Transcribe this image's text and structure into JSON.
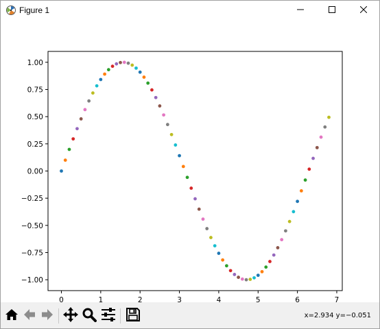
{
  "window": {
    "title": "Figure 1",
    "icons": {
      "app": "matplotlib-logo-icon",
      "minimize": "minimize-icon",
      "maximize": "maximize-icon",
      "close": "close-icon"
    }
  },
  "toolbar": {
    "buttons": [
      {
        "name": "home-button",
        "icon": "home-icon"
      },
      {
        "name": "back-button",
        "icon": "left-arrow-icon"
      },
      {
        "name": "forward-button",
        "icon": "right-arrow-icon"
      },
      {
        "name": "pan-button",
        "icon": "move-icon"
      },
      {
        "name": "zoom-button",
        "icon": "magnifier-icon"
      },
      {
        "name": "configure-subplots-button",
        "icon": "sliders-icon"
      },
      {
        "name": "save-button",
        "icon": "save-icon"
      }
    ],
    "status": "x=2.934 y=−0.051"
  },
  "chart_data": {
    "type": "scatter",
    "title": "",
    "xlabel": "",
    "ylabel": "",
    "xlim": [
      -0.34,
      7.14
    ],
    "ylim": [
      -1.1,
      1.1
    ],
    "xticks": [
      0,
      1,
      2,
      3,
      4,
      5,
      6,
      7
    ],
    "xtick_labels": [
      "0",
      "1",
      "2",
      "3",
      "4",
      "5",
      "6",
      "7"
    ],
    "yticks": [
      -1.0,
      -0.75,
      -0.5,
      -0.25,
      0.0,
      0.25,
      0.5,
      0.75,
      1.0
    ],
    "ytick_labels": [
      "−1.00",
      "−0.75",
      "−0.50",
      "−0.25",
      "0.00",
      "0.25",
      "0.50",
      "0.75",
      "1.00"
    ],
    "grid": false,
    "point_colors": [
      "#1f77b4",
      "#ff7f0e",
      "#2ca02c",
      "#d62728",
      "#9467bd",
      "#8c564b",
      "#e377c2",
      "#7f7f7f",
      "#bcbd22",
      "#17becf"
    ],
    "x": [
      0.0,
      0.1,
      0.2,
      0.3,
      0.4,
      0.5,
      0.6,
      0.7,
      0.8,
      0.9,
      1.0,
      1.1,
      1.2,
      1.3,
      1.4,
      1.5,
      1.6,
      1.7,
      1.8,
      1.9,
      2.0,
      2.1,
      2.2,
      2.3,
      2.4,
      2.5,
      2.6,
      2.7,
      2.8,
      2.9,
      3.0,
      3.1,
      3.2,
      3.3,
      3.4,
      3.5,
      3.6,
      3.7,
      3.8,
      3.9,
      4.0,
      4.1,
      4.2,
      4.3,
      4.4,
      4.5,
      4.6,
      4.7,
      4.8,
      4.9,
      5.0,
      5.1,
      5.2,
      5.3,
      5.4,
      5.5,
      5.6,
      5.7,
      5.8,
      5.9,
      6.0,
      6.1,
      6.2,
      6.3,
      6.4,
      6.5,
      6.6,
      6.7,
      6.8
    ],
    "y": [
      0.0,
      0.0998,
      0.1987,
      0.2955,
      0.3894,
      0.4794,
      0.5646,
      0.6442,
      0.7174,
      0.7833,
      0.8415,
      0.8912,
      0.932,
      0.9636,
      0.9854,
      0.9975,
      0.9996,
      0.9917,
      0.9738,
      0.9463,
      0.9093,
      0.8632,
      0.8085,
      0.7457,
      0.6755,
      0.5985,
      0.5155,
      0.4274,
      0.335,
      0.2392,
      0.1411,
      0.0416,
      -0.0584,
      -0.1577,
      -0.2555,
      -0.3508,
      -0.4425,
      -0.5298,
      -0.6119,
      -0.6878,
      -0.7568,
      -0.8183,
      -0.8716,
      -0.9162,
      -0.9516,
      -0.9775,
      -0.9937,
      -0.9999,
      -0.9962,
      -0.9825,
      -0.9589,
      -0.9258,
      -0.8835,
      -0.8323,
      -0.7728,
      -0.7055,
      -0.6313,
      -0.5507,
      -0.4646,
      -0.3739,
      -0.2794,
      -0.1822,
      -0.0831,
      0.0168,
      0.1165,
      0.2151,
      0.3115,
      0.4048,
      0.4941
    ]
  }
}
